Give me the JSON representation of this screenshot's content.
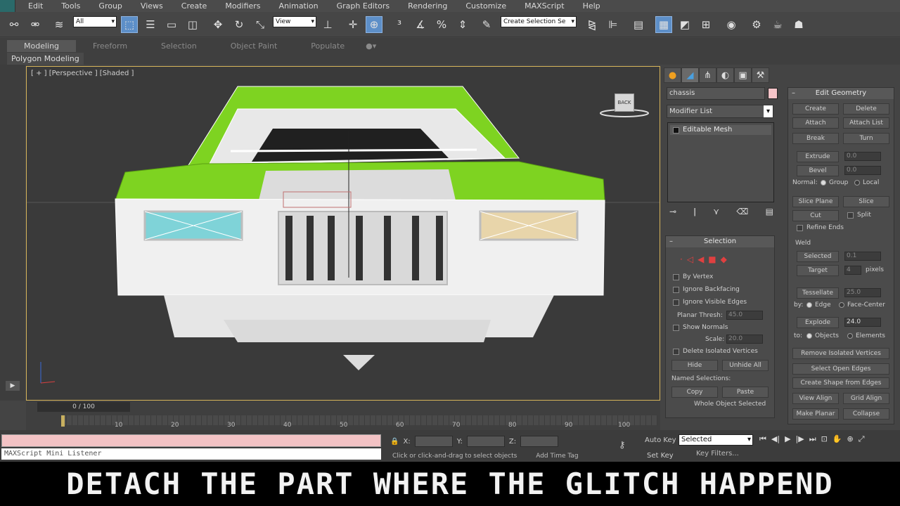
{
  "menu": [
    "Edit",
    "Tools",
    "Group",
    "Views",
    "Create",
    "Modifiers",
    "Animation",
    "Graph Editors",
    "Rendering",
    "Customize",
    "MAXScript",
    "Help"
  ],
  "toolbar": {
    "filter_value": "All",
    "refcoord_value": "View",
    "named_selection_placeholder": "Create Selection Se"
  },
  "ribbon": {
    "tabs": [
      "Modeling",
      "Freeform",
      "Selection",
      "Object Paint",
      "Populate"
    ],
    "active_tab": "Modeling",
    "sub_label": "Polygon Modeling"
  },
  "viewport": {
    "label": "[ + ] [Perspective ] [Shaded ]",
    "viewcube_label": "BACK"
  },
  "command_panel": {
    "object_name": "chassis",
    "object_color": "#f5c4c8",
    "modifier_list_label": "Modifier List",
    "stack_item": "Editable Mesh",
    "selection": {
      "title": "Selection",
      "by_vertex": "By Vertex",
      "ignore_backfacing": "Ignore Backfacing",
      "ignore_visible_edges": "Ignore Visible Edges",
      "planar_thresh_label": "Planar Thresh:",
      "planar_thresh_value": "45.0",
      "show_normals": "Show Normals",
      "scale_label": "Scale:",
      "scale_value": "20.0",
      "delete_isolated": "Delete Isolated Vertices",
      "hide": "Hide",
      "unhide_all": "Unhide All",
      "named_selections": "Named Selections:",
      "copy": "Copy",
      "paste": "Paste",
      "whole_object": "Whole Object Selected"
    },
    "edit_geometry": {
      "title": "Edit Geometry",
      "create": "Create",
      "delete": "Delete",
      "attach": "Attach",
      "attach_list": "Attach List",
      "break": "Break",
      "turn": "Turn",
      "extrude": "Extrude",
      "extrude_value": "0.0",
      "bevel": "Bevel",
      "bevel_value": "0.0",
      "normal_label": "Normal:",
      "group": "Group",
      "local": "Local",
      "slice_plane": "Slice Plane",
      "slice": "Slice",
      "cut": "Cut",
      "split": "Split",
      "refine_ends": "Refine Ends",
      "weld_label": "Weld",
      "selected": "Selected",
      "selected_value": "0.1",
      "target": "Target",
      "target_value": "4",
      "pixels": "pixels",
      "tessellate": "Tessellate",
      "tessellate_value": "25.0",
      "by_label": "by:",
      "edge": "Edge",
      "face_center": "Face-Center",
      "explode": "Explode",
      "explode_value": "24.0",
      "to_label": "to:",
      "objects": "Objects",
      "elements": "Elements",
      "remove_isolated": "Remove Isolated Vertices",
      "select_open_edges": "Select Open Edges",
      "create_shape": "Create Shape from Edges",
      "view_align": "View Align",
      "grid_align": "Grid Align",
      "make_planar": "Make Planar",
      "collapse": "Collapse"
    }
  },
  "timeline": {
    "slider_label": "0 / 100",
    "ticks": [
      "10",
      "20",
      "30",
      "40",
      "50",
      "60",
      "70",
      "80",
      "90",
      "100"
    ]
  },
  "status": {
    "listener": "MAXScript Mini Listener",
    "x_label": "X:",
    "y_label": "Y:",
    "z_label": "Z:",
    "prompt": "Click or click-and-drag to select objects",
    "add_time_tag": "Add Time Tag",
    "auto_key": "Auto Key",
    "set_key": "Set Key",
    "selected_value": "Selected",
    "key_filters": "Key Filters...",
    "frame_value": "0"
  },
  "caption": "DETACH THE PART WHERE THE GLITCH HAPPEND"
}
